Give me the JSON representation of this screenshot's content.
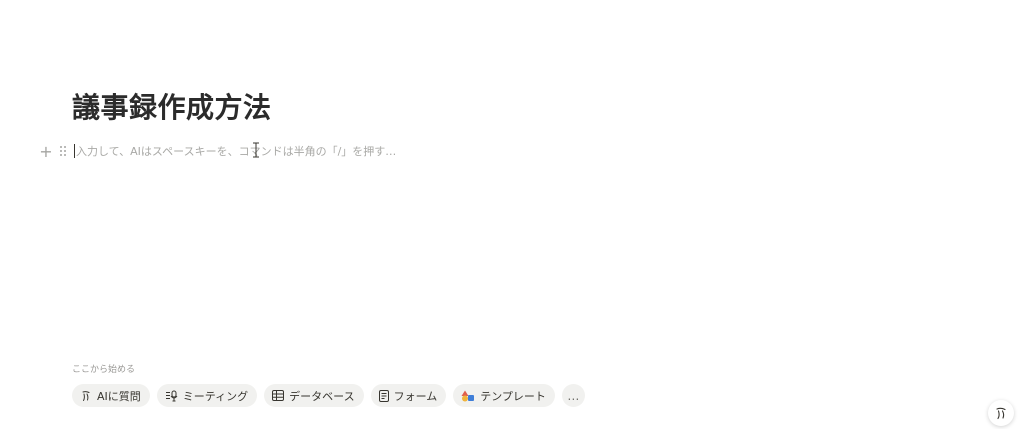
{
  "page": {
    "title": "議事録作成方法"
  },
  "editor": {
    "placeholder": "入力して、AIはスペースキーを、コマンドは半角の「/」を押す…"
  },
  "start_section": {
    "label": "ここから始める",
    "chips": [
      {
        "label": "AIに質問",
        "icon": "ai-face-icon"
      },
      {
        "label": "ミーティング",
        "icon": "meeting-icon"
      },
      {
        "label": "データベース",
        "icon": "table-icon"
      },
      {
        "label": "フォーム",
        "icon": "form-icon"
      },
      {
        "label": "テンプレート",
        "icon": "template-shapes-icon"
      },
      {
        "label": "…",
        "icon": "more-icon"
      }
    ]
  },
  "icons": {
    "block_add": "plus-icon",
    "block_drag": "drag-handle-icon",
    "floating_ai": "ai-face-icon"
  },
  "colors": {
    "text": "#37352f",
    "placeholder": "#a9a9a6",
    "chip_bg": "#f1f1ef",
    "template_red": "#e0604d",
    "template_blue": "#3f7ed8",
    "template_yellow": "#f0b43c"
  }
}
